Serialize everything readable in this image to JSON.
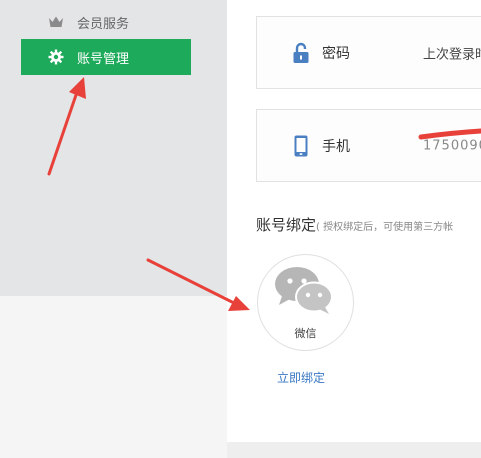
{
  "sidebar": {
    "items": [
      {
        "label": "会员服务",
        "icon": "crown-icon"
      },
      {
        "label": "账号管理",
        "icon": "gear-icon",
        "active": true
      }
    ]
  },
  "security": {
    "password": {
      "title": "密码",
      "value": "上次登录时"
    },
    "phone": {
      "title": "手机",
      "value": "1750090"
    }
  },
  "binding": {
    "heading": "账号绑定",
    "note": "( 授权绑定后，可使用第三方帐",
    "wechat_label": "微信",
    "bind_link": "立即绑定"
  },
  "colors": {
    "accent_green": "#1daa5b",
    "link_blue": "#3a78c3",
    "annotation_red": "#e8413a",
    "icon_blue": "#4a7fc1"
  }
}
